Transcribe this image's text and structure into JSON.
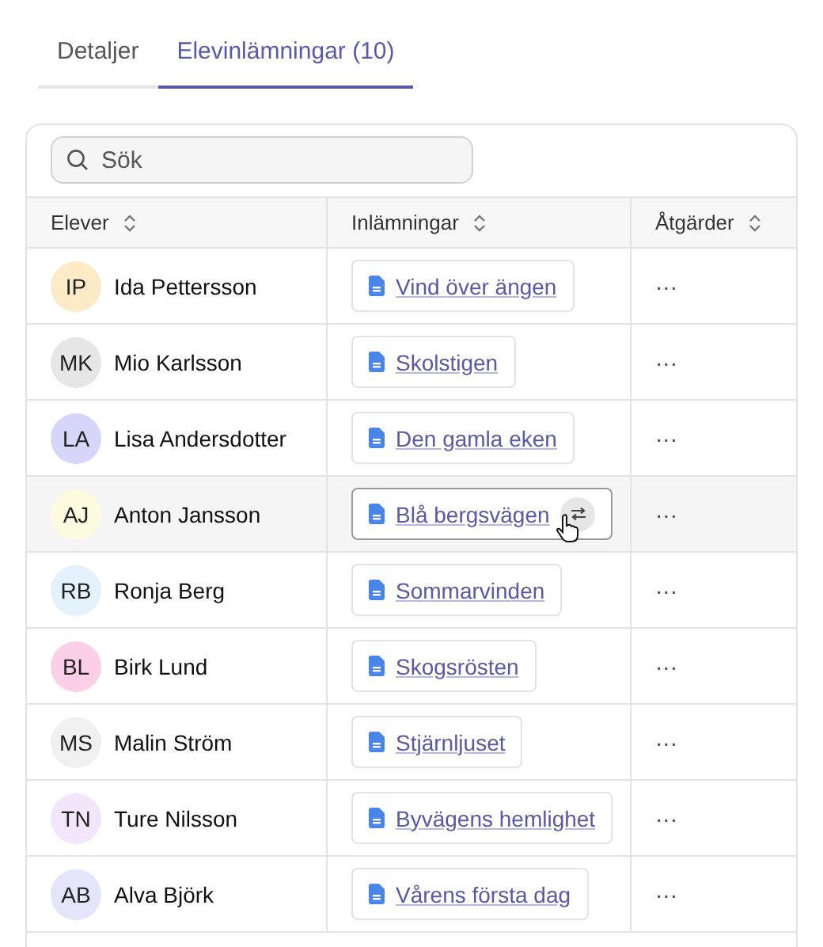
{
  "tabs": [
    {
      "label": "Detaljer",
      "selected": false
    },
    {
      "label": "Elevinlämningar (10)",
      "selected": true
    }
  ],
  "search": {
    "placeholder": "Sök"
  },
  "table": {
    "columns": [
      "Elever",
      "Inlämningar",
      "Åtgärder"
    ],
    "rows": [
      {
        "initials": "IP",
        "name": "Ida Pettersson",
        "color": "#fdebc8",
        "submission": "Vind över ängen",
        "actions": "···",
        "hovered": false
      },
      {
        "initials": "MK",
        "name": "Mio Karlsson",
        "color": "#e6e6e6",
        "submission": "Skolstigen",
        "actions": "···",
        "hovered": false
      },
      {
        "initials": "LA",
        "name": "Lisa Andersdotter",
        "color": "#d6d6fb",
        "submission": "Den gamla eken",
        "actions": "···",
        "hovered": false
      },
      {
        "initials": "AJ",
        "name": "Anton Jansson",
        "color": "#fcfbe0",
        "submission": "Blå bergsvägen",
        "actions": "···",
        "hovered": true
      },
      {
        "initials": "RB",
        "name": "Ronja Berg",
        "color": "#e3f2fd",
        "submission": "Sommarvinden",
        "actions": "···",
        "hovered": false
      },
      {
        "initials": "BL",
        "name": "Birk Lund",
        "color": "#fbcfe6",
        "submission": "Skogsrösten",
        "actions": "···",
        "hovered": false
      },
      {
        "initials": "MS",
        "name": "Malin Ström",
        "color": "#f0f0f0",
        "submission": "Stjärnljuset",
        "actions": "···",
        "hovered": false
      },
      {
        "initials": "TN",
        "name": "Ture Nilsson",
        "color": "#f3e6fb",
        "submission": "Byvägens hemlighet",
        "actions": "···",
        "hovered": false
      },
      {
        "initials": "AB",
        "name": "Alva Björk",
        "color": "#e4e4fb",
        "submission": "Vårens första dag",
        "actions": "···",
        "hovered": false
      }
    ]
  }
}
